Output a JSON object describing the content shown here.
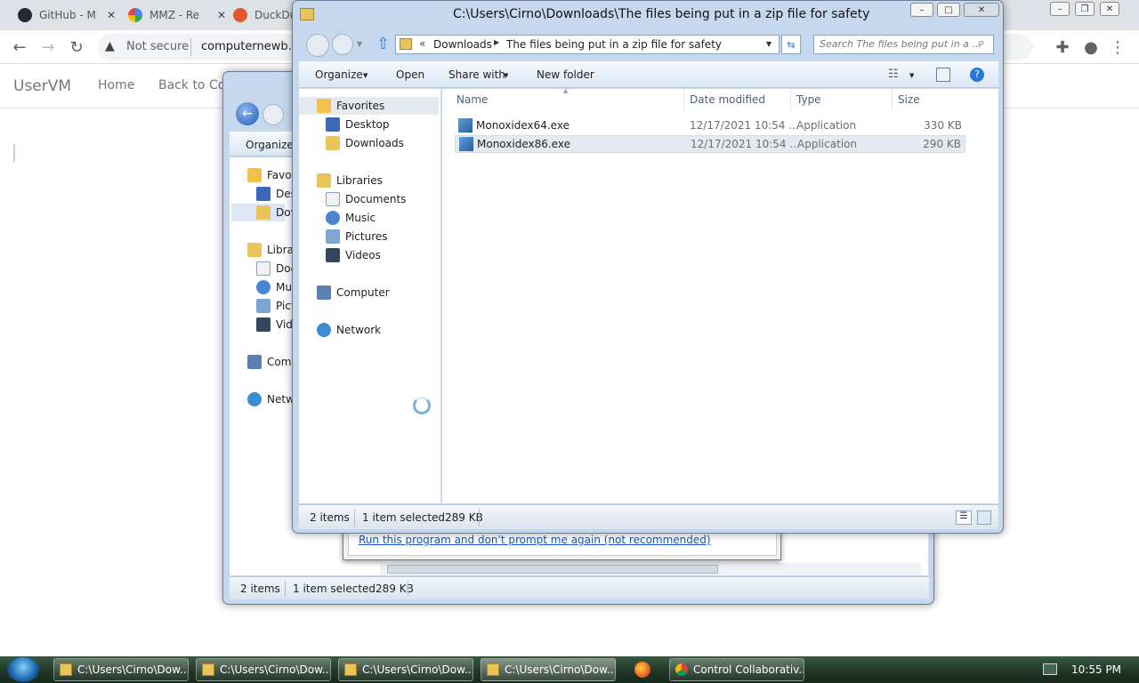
{
  "browser": {
    "tabs": [
      {
        "label": "GitHub - M",
        "icon": "github-icon"
      },
      {
        "label": "MMZ - Re",
        "icon": "google-icon"
      },
      {
        "label": "DuckDu",
        "icon": "duckduckgo-icon"
      }
    ],
    "security_label": "Not secure",
    "url": "computernewb.c"
  },
  "page": {
    "brand": "UserVM",
    "nav": [
      "Home",
      "Back to Col"
    ]
  },
  "back_window": {
    "organize": "Organize",
    "nav_items": [
      "Favor",
      "Des",
      "Dov",
      "Librar",
      "Doc",
      "Mu",
      "Pict",
      "Vide",
      "Comp",
      "Netw"
    ],
    "status_items": "2 items",
    "status_selected": "1 item selected",
    "status_size": "289 KB"
  },
  "security_dialog": {
    "link": "Run this program and don't prompt me again (not recommended)"
  },
  "front_window": {
    "title": "C:\\Users\\Cirno\\Downloads\\The files being put in a zip file for safety",
    "breadcrumb": [
      "Downloads",
      "The files being put in a zip file for safety"
    ],
    "breadcrumb_prefix": "«",
    "search_placeholder": "Search The files being put in a ...",
    "toolbar": {
      "organize": "Organize",
      "open": "Open",
      "share_with": "Share with",
      "new_folder": "New folder"
    },
    "nav": {
      "favorites": "Favorites",
      "desktop": "Desktop",
      "downloads": "Downloads",
      "libraries": "Libraries",
      "documents": "Documents",
      "music": "Music",
      "pictures": "Pictures",
      "videos": "Videos",
      "computer": "Computer",
      "network": "Network"
    },
    "columns": [
      "Name",
      "Date modified",
      "Type",
      "Size"
    ],
    "files": [
      {
        "name": "Monoxidex64.exe",
        "date": "12/17/2021 10:54 ...",
        "type": "Application",
        "size": "330 KB"
      },
      {
        "name": "Monoxidex86.exe",
        "date": "12/17/2021 10:54 ...",
        "type": "Application",
        "size": "290 KB"
      }
    ],
    "status_items": "2 items",
    "status_selected": "1 item selected",
    "status_size": "289 KB"
  },
  "taskbar": {
    "buttons": [
      "C:\\Users\\Cirno\\Dow...",
      "C:\\Users\\Cirno\\Dow...",
      "C:\\Users\\Cirno\\Dow...",
      "C:\\Users\\Cirno\\Dow..."
    ],
    "chrome_label": "Control Collaborativ...",
    "clock": "10:55 PM"
  },
  "colors": {
    "explorer_frame": "#c6d8ee",
    "selection": "#e5eaf1",
    "link": "#1a55b5",
    "taskbar": "#1f3426"
  }
}
